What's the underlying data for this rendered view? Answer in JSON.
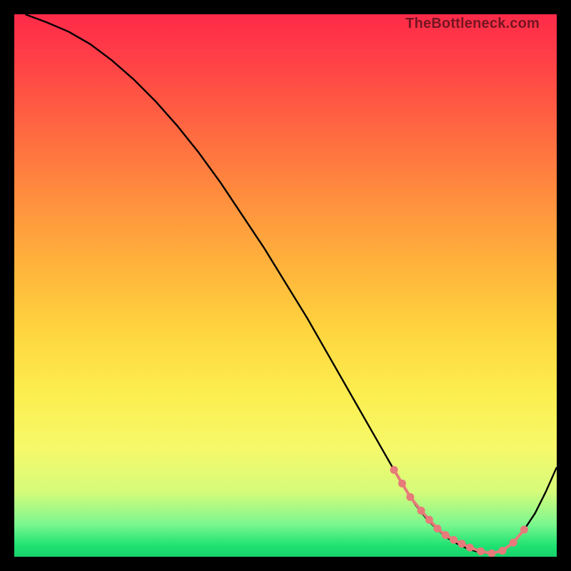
{
  "watermark": "TheBottleneck.com",
  "chart_data": {
    "type": "line",
    "title": "",
    "xlabel": "",
    "ylabel": "",
    "xlim": [
      0,
      100
    ],
    "ylim": [
      0,
      100
    ],
    "series": [
      {
        "name": "curve",
        "x": [
          2,
          6,
          10,
          14,
          18,
          22,
          26,
          30,
          34,
          38,
          42,
          46,
          50,
          54,
          58,
          62,
          66,
          70,
          72,
          74,
          76,
          78,
          80,
          82,
          84,
          86,
          88,
          90,
          92,
          94,
          96,
          98,
          100
        ],
        "y": [
          100,
          98.5,
          96.8,
          94.5,
          91.5,
          88,
          84,
          79.5,
          74.5,
          69,
          63,
          57,
          50.5,
          44,
          37,
          30,
          23,
          16,
          12.5,
          9.5,
          7,
          5,
          3.4,
          2.2,
          1.3,
          0.8,
          0.6,
          1.1,
          2.6,
          5,
          8,
          12,
          16.5
        ]
      }
    ],
    "markers": {
      "name": "valley-points",
      "color": "#e77a7a",
      "x": [
        70,
        71.5,
        73,
        75,
        76.5,
        78,
        79.5,
        81,
        82.5,
        84,
        86,
        88,
        90,
        92,
        94
      ],
      "y": [
        16,
        13.5,
        11,
        8.5,
        6.8,
        5.2,
        4,
        3.1,
        2.4,
        1.7,
        1.0,
        0.6,
        1.1,
        2.6,
        5
      ]
    },
    "background_gradient": {
      "top": "#ff2a49",
      "bottom": "#18d36a",
      "stops": [
        "#ff2a49",
        "#ff6a41",
        "#ffb23c",
        "#fcee4f",
        "#7bf78f",
        "#18d36a"
      ]
    }
  }
}
